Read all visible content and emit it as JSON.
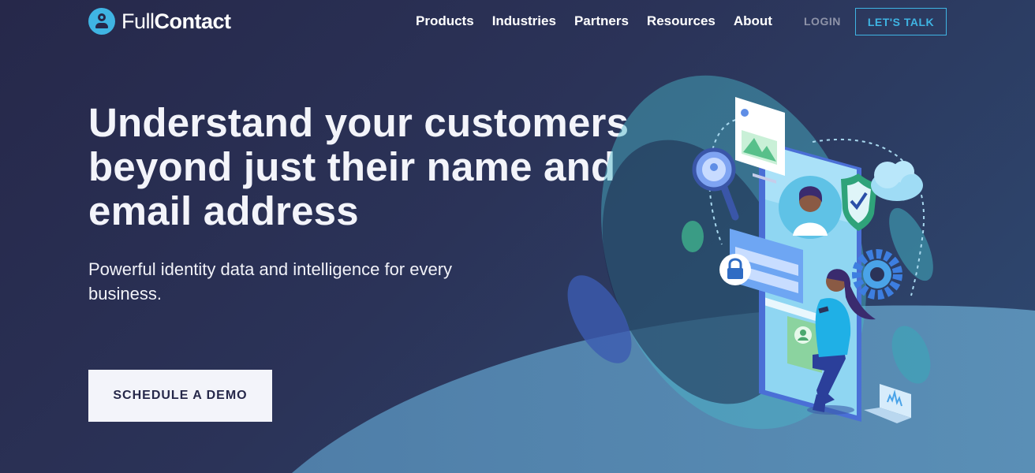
{
  "brand": {
    "name_light": "Full",
    "name_bold": "Contact",
    "accent": "#3fb4e3"
  },
  "nav": {
    "items": [
      {
        "label": "Products"
      },
      {
        "label": "Industries"
      },
      {
        "label": "Partners"
      },
      {
        "label": "Resources"
      },
      {
        "label": "About"
      }
    ],
    "login_label": "LOGIN",
    "talk_label": "LET'S TALK"
  },
  "hero": {
    "headline": "Understand your customers beyond just their name and email address",
    "subtext": "Powerful identity data and intelligence for every business.",
    "cta_label": "SCHEDULE A DEMO"
  },
  "colors": {
    "background": "#26284a",
    "wave": "#5a8db5",
    "cta_bg": "#f3f4fa"
  },
  "illustration": {
    "icons": [
      "image-card-icon",
      "magnifier-icon",
      "shield-check-icon",
      "cloud-icon",
      "lock-icon",
      "gear-icon",
      "user-card-icon",
      "laptop-icon",
      "person-avatar-icon",
      "woman-with-phone-figure"
    ]
  }
}
